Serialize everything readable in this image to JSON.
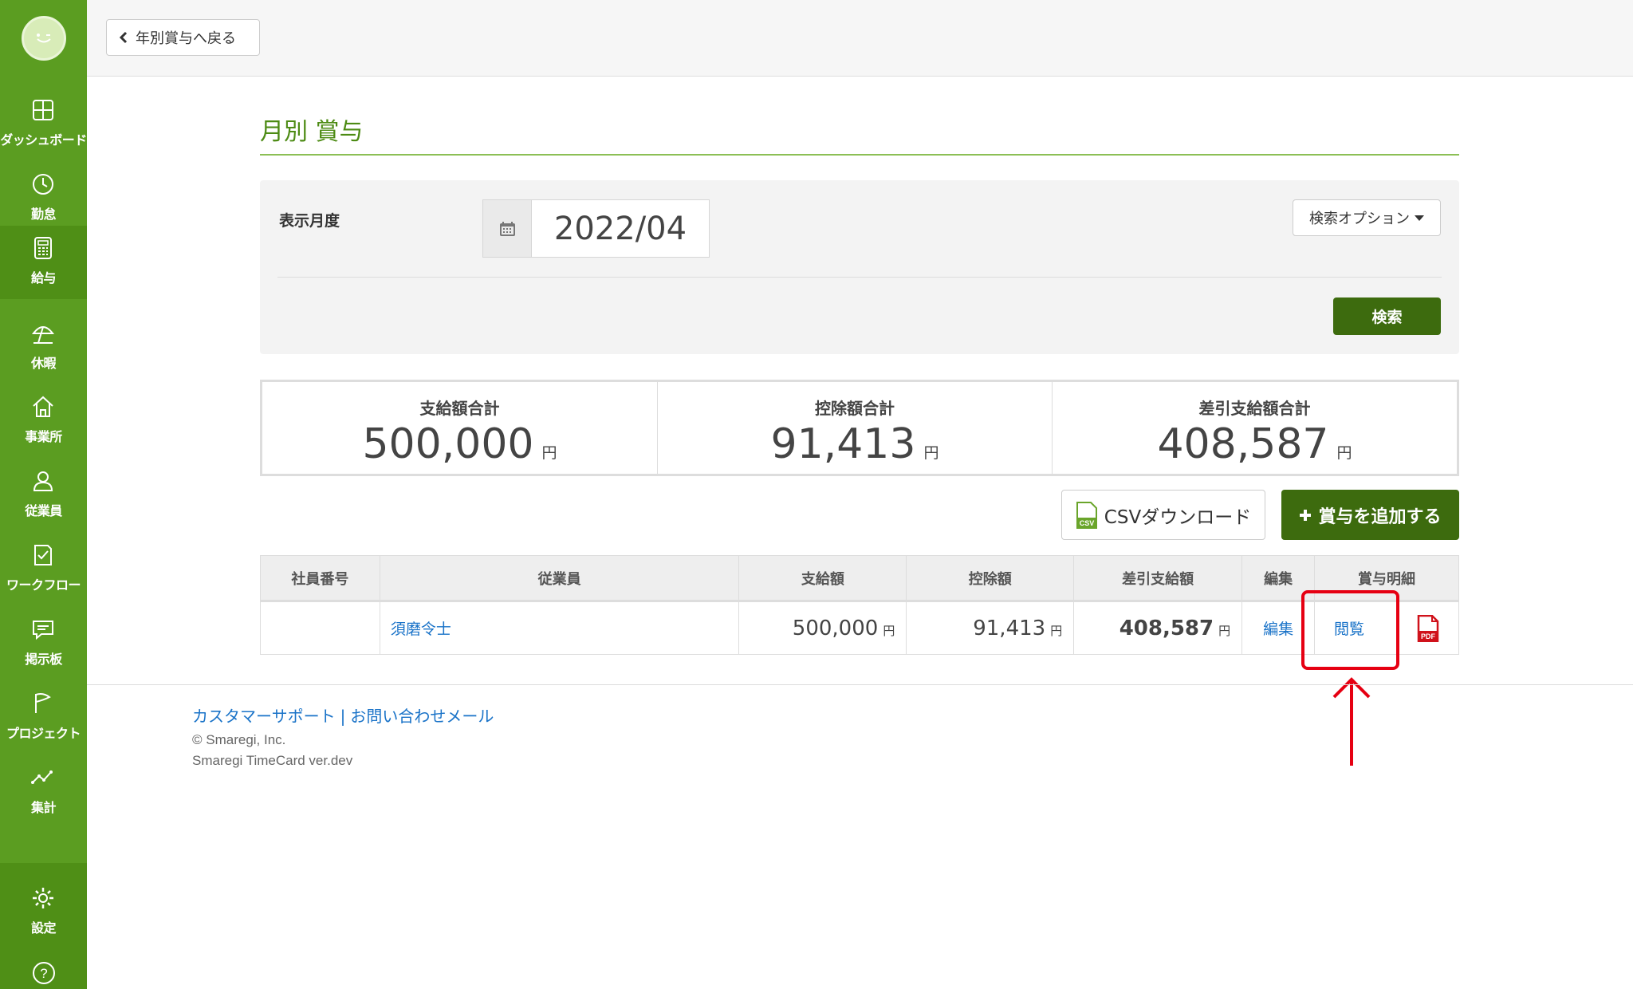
{
  "sidebar": {
    "items": [
      {
        "label": "ダッシュボード",
        "icon": "dashboard-icon"
      },
      {
        "label": "勤怠",
        "icon": "clock-icon"
      },
      {
        "label": "給与",
        "icon": "calculator-icon",
        "active": true
      },
      {
        "label": "休暇",
        "icon": "beach-umbrella-icon"
      },
      {
        "label": "事業所",
        "icon": "home-icon"
      },
      {
        "label": "従業員",
        "icon": "person-icon"
      },
      {
        "label": "ワークフロー",
        "icon": "checklist-icon"
      },
      {
        "label": "掲示板",
        "icon": "chat-icon"
      },
      {
        "label": "プロジェクト",
        "icon": "flag-icon"
      },
      {
        "label": "集計",
        "icon": "line-chart-icon"
      }
    ],
    "settings_label": "設定",
    "colors": {
      "bg": "#5b9d21",
      "active": "#4f8f16"
    }
  },
  "topbar": {
    "back_label": "年別賞与へ戻る"
  },
  "page": {
    "title": "月別 賞与"
  },
  "filter": {
    "month_label": "表示月度",
    "month_value": "2022/04",
    "options_label": "検索オプション",
    "search_label": "検索"
  },
  "summary": {
    "paid_total": {
      "label": "支給額合計",
      "value": "500,000",
      "unit": "円"
    },
    "deduction_total": {
      "label": "控除額合計",
      "value": "91,413",
      "unit": "円"
    },
    "net_total": {
      "label": "差引支給額合計",
      "value": "408,587",
      "unit": "円"
    }
  },
  "actions": {
    "csv_label": "CSVダウンロード",
    "add_label": "賞与を追加する"
  },
  "table": {
    "headers": [
      "社員番号",
      "従業員",
      "支給額",
      "控除額",
      "差引支給額",
      "編集",
      "賞与明細"
    ],
    "rows": [
      {
        "employee_no": "",
        "employee": "須磨令士",
        "paid": "500,000",
        "deduction": "91,413",
        "net": "408,587",
        "unit": "円",
        "edit": "編集",
        "view": "閲覧"
      }
    ]
  },
  "footer": {
    "support": "カスタマーサポート",
    "separator": "|",
    "contact": "お問い合わせメール",
    "copyright": "© Smaregi, Inc.",
    "version": "Smaregi TimeCard ver.dev"
  },
  "colors": {
    "accent": "#4d8b14",
    "primary_button": "#3d6b0e",
    "link": "#1a73c8",
    "highlight": "#e60012"
  }
}
